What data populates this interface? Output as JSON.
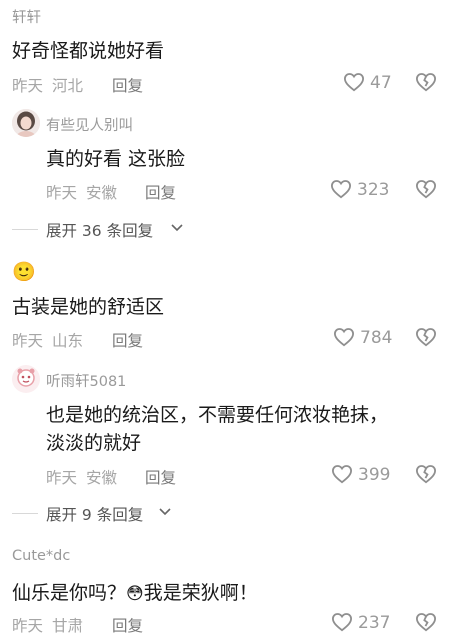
{
  "comments": [
    {
      "username": "轩轩",
      "text": "好奇怪都说她好看",
      "time": "昨天",
      "location": "河北",
      "reply_label": "回复",
      "likes": "47",
      "replies": [
        {
          "username": "有些见人别叫",
          "text": "真的好看  这张脸",
          "time": "昨天",
          "location": "安徽",
          "reply_label": "回复",
          "likes": "323"
        }
      ],
      "expand_label": "展开 36 条回复"
    },
    {
      "username_emoji": "🙂",
      "text": "古装是她的舒适区",
      "time": "昨天",
      "location": "山东",
      "reply_label": "回复",
      "likes": "784",
      "replies": [
        {
          "username": "听雨轩5081",
          "text_line1": "也是她的统治区，不需要任何浓妆艳抹，",
          "text_line2": "淡淡的就好",
          "time": "昨天",
          "location": "安徽",
          "reply_label": "回复",
          "likes": "399"
        }
      ],
      "expand_label": "展开 9 条回复"
    },
    {
      "username": "Cute*dc",
      "text_part1": "仙乐是你吗？",
      "emoji": "😳",
      "text_part2": "我是荣狄啊！",
      "time": "昨天",
      "location": "甘肃",
      "reply_label": "回复",
      "likes": "237"
    }
  ],
  "icons": {
    "like": "heart-icon",
    "dislike": "broken-heart-icon",
    "expand": "chevron-down-icon"
  },
  "colors": {
    "primary_text": "#1a1a1a",
    "secondary_text": "#9a9a9a",
    "icon_stroke": "#8f8f8f",
    "avatar_pink": "#e8a0a8"
  }
}
